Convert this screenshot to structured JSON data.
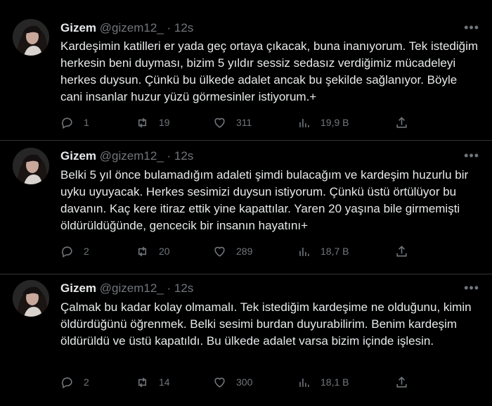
{
  "tweets": [
    {
      "name": "Gizem",
      "handle": "@gizem12_",
      "separator": "·",
      "time": "12s",
      "text": "Kardeşimin katilleri er yada geç ortaya çıkacak, buna inanıyorum. Tek istediğim herkesin beni duyması, bizim 5 yıldır sessiz sedasız verdiğimiz mücadeleyi herkes duysun. Çünkü bu ülkede adalet ancak bu şekilde sağlanıyor. Böyle cani insanlar huzur yüzü görmesinler istiyorum.+",
      "replies": "1",
      "retweets": "19",
      "likes": "311",
      "views": "19,9 B"
    },
    {
      "name": "Gizem",
      "handle": "@gizem12_",
      "separator": "·",
      "time": "12s",
      "text": "Belki 5 yıl önce bulamadığım adaleti şimdi bulacağım ve kardeşim huzurlu bir uyku uyuyacak. Herkes sesimizi duysun istiyorum. Çünkü üstü örtülüyor bu davanın. Kaç kere itiraz ettik yine kapattılar. Yaren 20 yaşına bile girmemişti öldürüldüğünde, gencecik bir insanın hayatını+",
      "replies": "2",
      "retweets": "20",
      "likes": "289",
      "views": "18,7 B"
    },
    {
      "name": "Gizem",
      "handle": "@gizem12_",
      "separator": "·",
      "time": "12s",
      "text": "Çalmak bu kadar kolay olmamalı. Tek istediğim kardeşime ne olduğunu, kimin öldürdüğünü öğrenmek. Belki sesimi burdan duyurabilirim. Benim kardeşim öldürüldü ve üstü kapatıldı. Bu ülkede adalet varsa bizim içinde işlesin.",
      "replies": "2",
      "retweets": "14",
      "likes": "300",
      "views": "18,1 B"
    }
  ],
  "icons": {
    "more": "more-horizontal-icon",
    "reply": "reply-bubble-icon",
    "retweet": "retweet-icon",
    "like": "heart-icon",
    "views": "views-chart-icon",
    "share": "share-upload-icon"
  },
  "colors": {
    "background": "#000000",
    "text": "#e7e9ea",
    "muted": "#71767b",
    "divider": "#2f3336"
  }
}
